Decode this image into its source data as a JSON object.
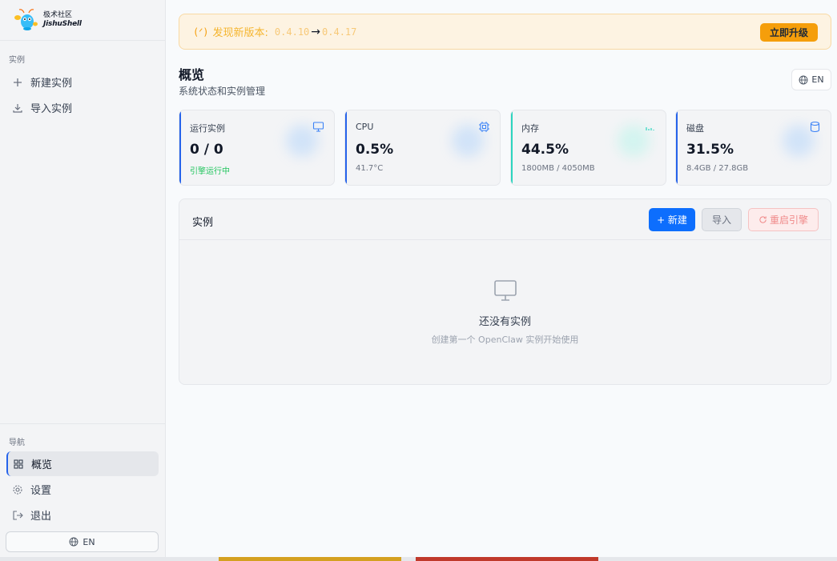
{
  "brand": {
    "cn": "极术社区",
    "en": "JishuShell"
  },
  "sidebar": {
    "section_instances": "实例",
    "items": [
      {
        "label": "新建实例",
        "icon": "plus-icon"
      },
      {
        "label": "导入实例",
        "icon": "download-icon"
      }
    ],
    "section_nav": "导航",
    "nav": [
      {
        "label": "概览",
        "icon": "grid-icon",
        "active": true
      },
      {
        "label": "设置",
        "icon": "gear-icon"
      },
      {
        "label": "退出",
        "icon": "logout-icon"
      }
    ],
    "lang": "EN"
  },
  "banner": {
    "icon": "(ᐟ)",
    "text": "发现新版本:",
    "from_version": "0.4.10",
    "arrow": "→",
    "to_version": "0.4.17",
    "upgrade_label": "立即升级"
  },
  "header": {
    "title": "概览",
    "subtitle": "系统状态和实例管理",
    "lang": "EN"
  },
  "stats": [
    {
      "label": "运行实例",
      "value": "0 / 0",
      "sub": "引擎运行中",
      "icon": "monitor-icon",
      "accent": "#2563eb"
    },
    {
      "label": "CPU",
      "value": "0.5%",
      "sub": "41.7°C",
      "icon": "chip-icon",
      "accent": "#2563eb"
    },
    {
      "label": "内存",
      "value": "44.5%",
      "sub": "1800MB / 4050MB",
      "icon": "bars-icon",
      "accent": "#2dd4bf"
    },
    {
      "label": "磁盘",
      "value": "31.5%",
      "sub": "8.4GB / 27.8GB",
      "icon": "database-icon",
      "accent": "#2563eb"
    }
  ],
  "instances": {
    "title": "实例",
    "new_label": "+ 新建",
    "import_label": "导入",
    "restart_label": "重启引擎",
    "empty_title": "还没有实例",
    "empty_desc": "创建第一个 OpenClaw 实例开始使用"
  }
}
